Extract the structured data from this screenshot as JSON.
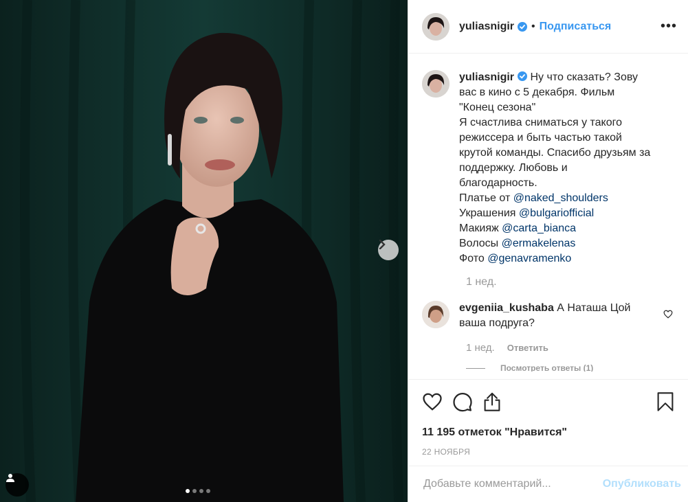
{
  "post": {
    "username": "yuliasnigir",
    "separator": "•",
    "follow_label": "Подписаться",
    "more_label": "•••"
  },
  "caption": {
    "lines": [
      "Ну что сказать? Зову",
      "вас в кино с 5 декабря. Фильм",
      "\"Конец сезона\"",
      "Я счастлива сниматься у такого",
      "режиссера и быть частью такой",
      "крутой команды. Спасибо друзьям за",
      "поддержку. Любовь и",
      "благодарность."
    ],
    "credits": [
      {
        "label": "Платье от ",
        "mention": "@naked_shoulders"
      },
      {
        "label": "Украшения ",
        "mention": "@bulgariofficial"
      },
      {
        "label": "Макияж ",
        "mention": "@carta_bianca"
      },
      {
        "label": "Волосы ",
        "mention": "@ermakelenas"
      },
      {
        "label": "Фото ",
        "mention": "@genavramenko"
      }
    ],
    "time": "1 нед."
  },
  "comment": {
    "username": "evgeniia_kushaba",
    "text_line1": "А Наташа Цой",
    "text_line2": "ваша подруга?",
    "time": "1 нед.",
    "reply_label": "Ответить",
    "view_replies": "Посмотреть ответы (1)"
  },
  "stats": {
    "likes": "11 195 отметок \"Нравится\"",
    "date": "22 НОЯБРЯ"
  },
  "add_comment": {
    "placeholder": "Добавьте комментарий...",
    "publish_label": "Опубликовать"
  },
  "carousel": {
    "slide_count": 4,
    "active_index": 0
  },
  "colors": {
    "accent": "#3897f0",
    "mention": "#003569",
    "muted": "#999999",
    "publish_disabled": "#b2dffc",
    "photo_background": "#0f2a26"
  },
  "icons": {
    "verified": "verified-badge-icon",
    "like": "heart-icon",
    "comment": "comment-bubble-icon",
    "share": "share-icon",
    "save": "bookmark-icon",
    "next": "chevron-right-icon",
    "tagged": "user-tag-icon"
  }
}
